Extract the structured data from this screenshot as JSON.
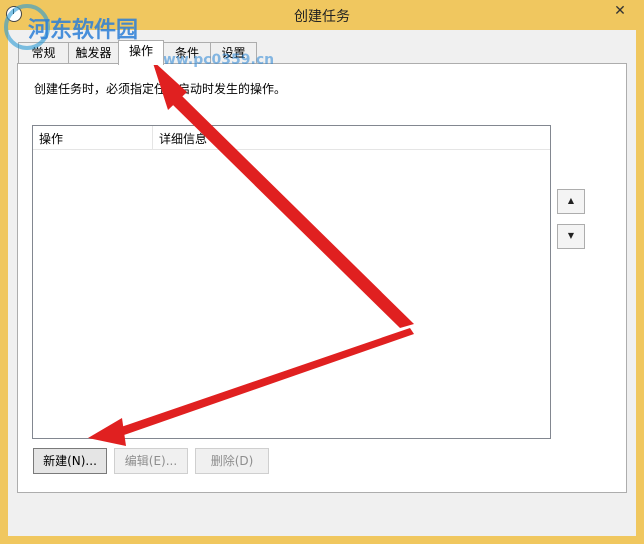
{
  "window": {
    "title": "创建任务"
  },
  "watermark": {
    "name": "河东软件园",
    "url": "www.pc0359.cn"
  },
  "tabs": [
    {
      "label": "常规",
      "active": false
    },
    {
      "label": "触发器",
      "active": false
    },
    {
      "label": "操作",
      "active": true
    },
    {
      "label": "条件",
      "active": false
    },
    {
      "label": "设置",
      "active": false
    }
  ],
  "actions_panel": {
    "description": "创建任务时，必须指定任务启动时发生的操作。",
    "columns": {
      "action": "操作",
      "details": "详细信息"
    },
    "rows": []
  },
  "buttons": {
    "new": "新建(N)...",
    "edit": "编辑(E)...",
    "delete": "删除(D)"
  },
  "icons": {
    "move_up": "triangle-up-icon",
    "move_down": "triangle-down-icon",
    "close": "close-icon"
  },
  "colors": {
    "titlebar": "#f0c75f",
    "annotation_arrow": "#e02020"
  }
}
